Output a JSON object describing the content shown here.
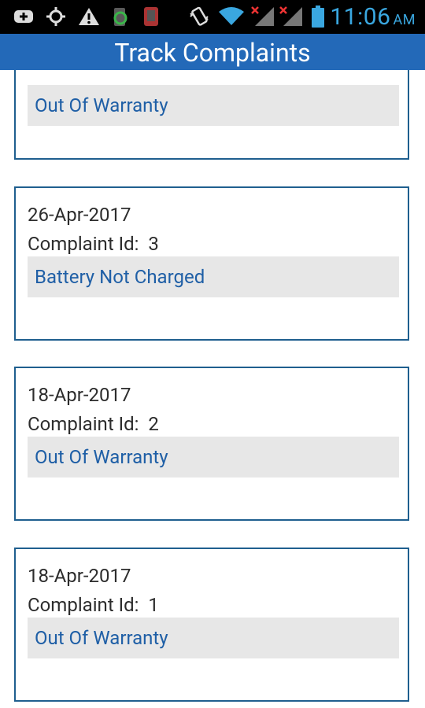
{
  "status_bar": {
    "time": "11:06",
    "ampm": "AM",
    "icons": [
      "add-box-icon",
      "gps-icon",
      "warning-icon",
      "battery-app-icon",
      "phone-app-icon",
      "vibrate-icon",
      "wifi-icon",
      "signal-x-icon",
      "signal-x-icon",
      "battery-icon"
    ]
  },
  "app_bar": {
    "title": "Track Complaints"
  },
  "complaints": [
    {
      "date": "",
      "id_label": "",
      "status": "Out Of Warranty"
    },
    {
      "date": "26-Apr-2017",
      "id_label": "Complaint Id:  3",
      "status": "Battery Not Charged"
    },
    {
      "date": "18-Apr-2017",
      "id_label": "Complaint Id:  2",
      "status": "Out Of Warranty"
    },
    {
      "date": "18-Apr-2017",
      "id_label": "Complaint Id:  1",
      "status": "Out Of Warranty"
    }
  ],
  "colors": {
    "app_bar": "#2369b8",
    "status_text": "#1f5fa6",
    "card_border": "#1f5f8f"
  }
}
